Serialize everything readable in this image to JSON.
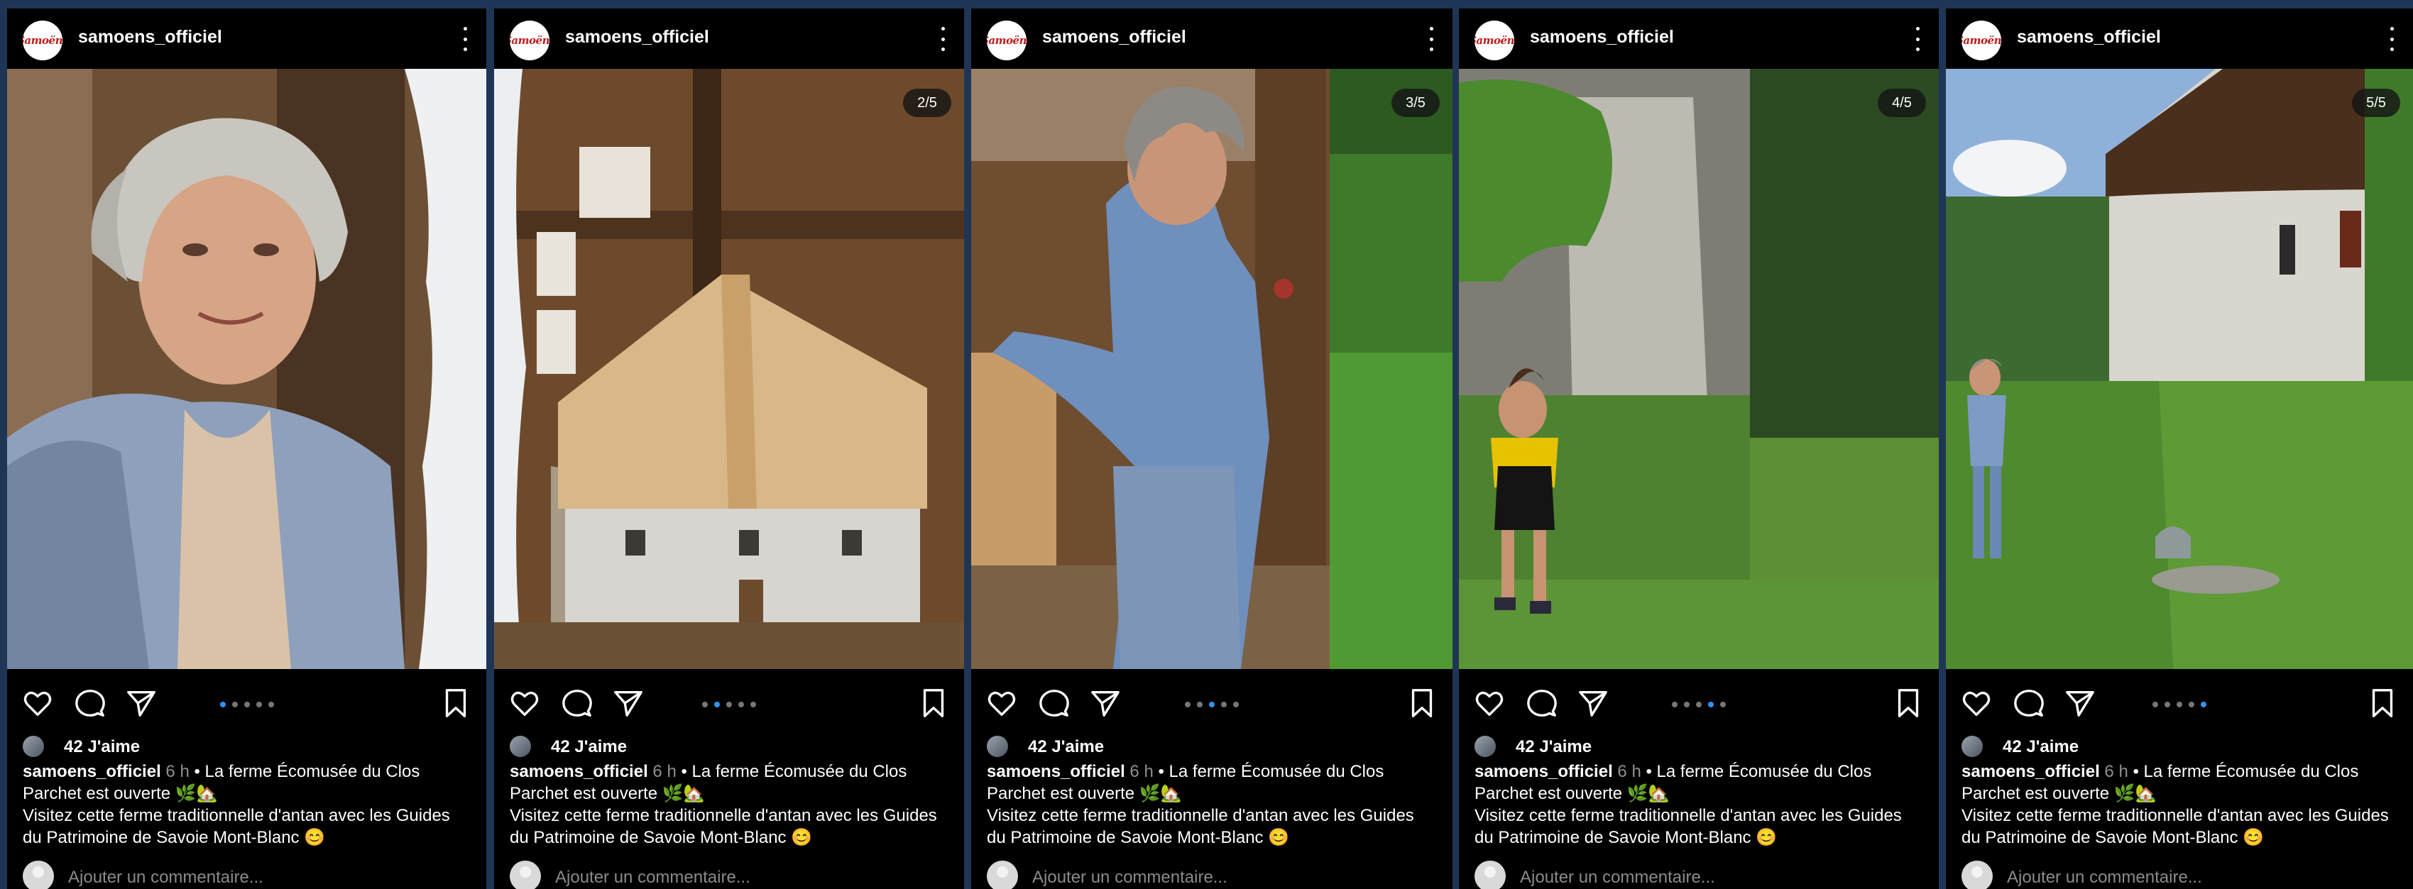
{
  "account": {
    "username": "samoens_officiel",
    "avatar_text": "Samoëns"
  },
  "post": {
    "likes": "42 J'aime",
    "time": "6 h",
    "caption_line1": " • La ferme Écomusée du Clos Parchet est ouverte 🌿🏡",
    "caption_line2": "Visitez cette ferme traditionnelle d'antan avec les Guides du Patrimoine de Savoie Mont-Blanc 😊",
    "comment_placeholder": "Ajouter un commentaire..."
  },
  "slides": [
    {
      "index": 1,
      "counter": "",
      "description_icon": "portrait-photo"
    },
    {
      "index": 2,
      "counter": "2/5"
    },
    {
      "index": 3,
      "counter": "3/5"
    },
    {
      "index": 4,
      "counter": "4/5"
    },
    {
      "index": 5,
      "counter": "5/5"
    }
  ],
  "colors": {
    "background": "#1f3556",
    "panel": "#000000",
    "active_dot": "#2f94f5",
    "inactive_dot": "#777777",
    "muted_text": "#8f8f8f"
  }
}
